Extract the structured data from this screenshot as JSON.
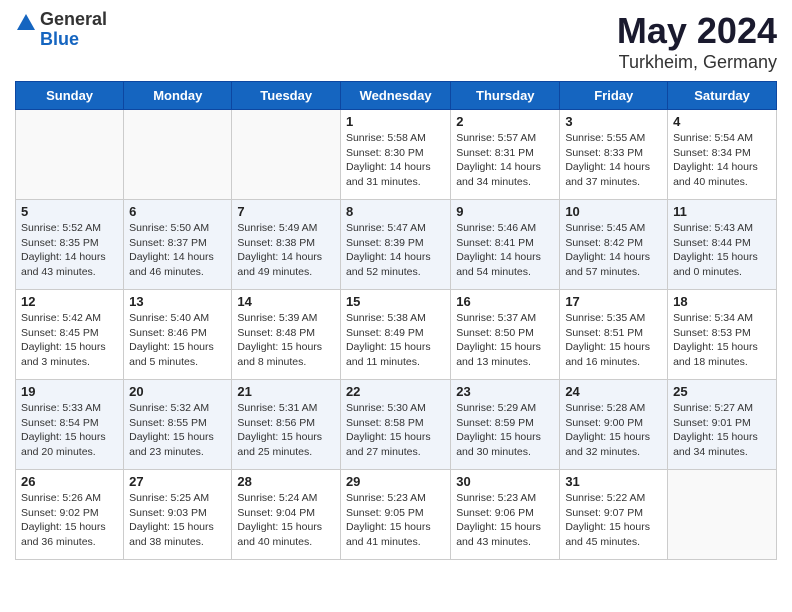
{
  "logo": {
    "general": "General",
    "blue": "Blue"
  },
  "title": "May 2024",
  "subtitle": "Turkheim, Germany",
  "days_of_week": [
    "Sunday",
    "Monday",
    "Tuesday",
    "Wednesday",
    "Thursday",
    "Friday",
    "Saturday"
  ],
  "weeks": [
    [
      {
        "day": "",
        "info": ""
      },
      {
        "day": "",
        "info": ""
      },
      {
        "day": "",
        "info": ""
      },
      {
        "day": "1",
        "info": "Sunrise: 5:58 AM\nSunset: 8:30 PM\nDaylight: 14 hours\nand 31 minutes."
      },
      {
        "day": "2",
        "info": "Sunrise: 5:57 AM\nSunset: 8:31 PM\nDaylight: 14 hours\nand 34 minutes."
      },
      {
        "day": "3",
        "info": "Sunrise: 5:55 AM\nSunset: 8:33 PM\nDaylight: 14 hours\nand 37 minutes."
      },
      {
        "day": "4",
        "info": "Sunrise: 5:54 AM\nSunset: 8:34 PM\nDaylight: 14 hours\nand 40 minutes."
      }
    ],
    [
      {
        "day": "5",
        "info": "Sunrise: 5:52 AM\nSunset: 8:35 PM\nDaylight: 14 hours\nand 43 minutes."
      },
      {
        "day": "6",
        "info": "Sunrise: 5:50 AM\nSunset: 8:37 PM\nDaylight: 14 hours\nand 46 minutes."
      },
      {
        "day": "7",
        "info": "Sunrise: 5:49 AM\nSunset: 8:38 PM\nDaylight: 14 hours\nand 49 minutes."
      },
      {
        "day": "8",
        "info": "Sunrise: 5:47 AM\nSunset: 8:39 PM\nDaylight: 14 hours\nand 52 minutes."
      },
      {
        "day": "9",
        "info": "Sunrise: 5:46 AM\nSunset: 8:41 PM\nDaylight: 14 hours\nand 54 minutes."
      },
      {
        "day": "10",
        "info": "Sunrise: 5:45 AM\nSunset: 8:42 PM\nDaylight: 14 hours\nand 57 minutes."
      },
      {
        "day": "11",
        "info": "Sunrise: 5:43 AM\nSunset: 8:44 PM\nDaylight: 15 hours\nand 0 minutes."
      }
    ],
    [
      {
        "day": "12",
        "info": "Sunrise: 5:42 AM\nSunset: 8:45 PM\nDaylight: 15 hours\nand 3 minutes."
      },
      {
        "day": "13",
        "info": "Sunrise: 5:40 AM\nSunset: 8:46 PM\nDaylight: 15 hours\nand 5 minutes."
      },
      {
        "day": "14",
        "info": "Sunrise: 5:39 AM\nSunset: 8:48 PM\nDaylight: 15 hours\nand 8 minutes."
      },
      {
        "day": "15",
        "info": "Sunrise: 5:38 AM\nSunset: 8:49 PM\nDaylight: 15 hours\nand 11 minutes."
      },
      {
        "day": "16",
        "info": "Sunrise: 5:37 AM\nSunset: 8:50 PM\nDaylight: 15 hours\nand 13 minutes."
      },
      {
        "day": "17",
        "info": "Sunrise: 5:35 AM\nSunset: 8:51 PM\nDaylight: 15 hours\nand 16 minutes."
      },
      {
        "day": "18",
        "info": "Sunrise: 5:34 AM\nSunset: 8:53 PM\nDaylight: 15 hours\nand 18 minutes."
      }
    ],
    [
      {
        "day": "19",
        "info": "Sunrise: 5:33 AM\nSunset: 8:54 PM\nDaylight: 15 hours\nand 20 minutes."
      },
      {
        "day": "20",
        "info": "Sunrise: 5:32 AM\nSunset: 8:55 PM\nDaylight: 15 hours\nand 23 minutes."
      },
      {
        "day": "21",
        "info": "Sunrise: 5:31 AM\nSunset: 8:56 PM\nDaylight: 15 hours\nand 25 minutes."
      },
      {
        "day": "22",
        "info": "Sunrise: 5:30 AM\nSunset: 8:58 PM\nDaylight: 15 hours\nand 27 minutes."
      },
      {
        "day": "23",
        "info": "Sunrise: 5:29 AM\nSunset: 8:59 PM\nDaylight: 15 hours\nand 30 minutes."
      },
      {
        "day": "24",
        "info": "Sunrise: 5:28 AM\nSunset: 9:00 PM\nDaylight: 15 hours\nand 32 minutes."
      },
      {
        "day": "25",
        "info": "Sunrise: 5:27 AM\nSunset: 9:01 PM\nDaylight: 15 hours\nand 34 minutes."
      }
    ],
    [
      {
        "day": "26",
        "info": "Sunrise: 5:26 AM\nSunset: 9:02 PM\nDaylight: 15 hours\nand 36 minutes."
      },
      {
        "day": "27",
        "info": "Sunrise: 5:25 AM\nSunset: 9:03 PM\nDaylight: 15 hours\nand 38 minutes."
      },
      {
        "day": "28",
        "info": "Sunrise: 5:24 AM\nSunset: 9:04 PM\nDaylight: 15 hours\nand 40 minutes."
      },
      {
        "day": "29",
        "info": "Sunrise: 5:23 AM\nSunset: 9:05 PM\nDaylight: 15 hours\nand 41 minutes."
      },
      {
        "day": "30",
        "info": "Sunrise: 5:23 AM\nSunset: 9:06 PM\nDaylight: 15 hours\nand 43 minutes."
      },
      {
        "day": "31",
        "info": "Sunrise: 5:22 AM\nSunset: 9:07 PM\nDaylight: 15 hours\nand 45 minutes."
      },
      {
        "day": "",
        "info": ""
      }
    ]
  ]
}
